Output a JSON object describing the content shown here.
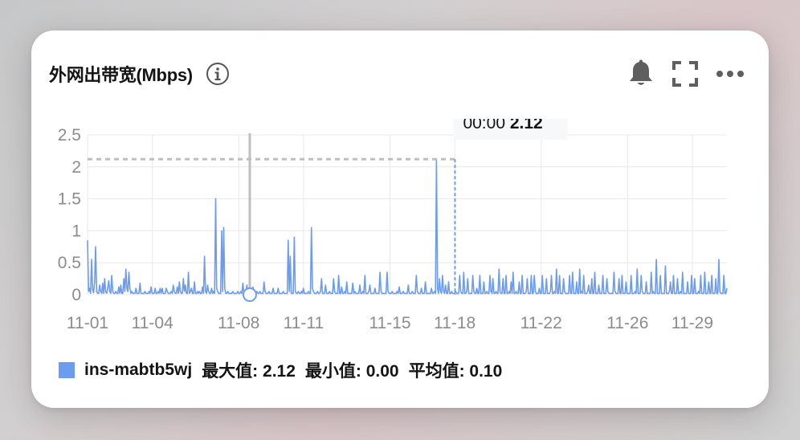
{
  "card": {
    "title": "外网出带宽(Mbps)",
    "icons": {
      "info": "info-circle-icon",
      "alert": "bell-icon",
      "fullscreen": "expand-icon",
      "more": "more-dots-icon"
    }
  },
  "legend": {
    "name": "ins-mabtb5wj",
    "max_label": "最大值: 2.12",
    "min_label": "最小值: 0.00",
    "avg_label": "平均值: 0.10"
  },
  "tooltip": {
    "time": "00:00",
    "value": "2.12"
  },
  "colors": {
    "series": "#6b9cf0",
    "grid": "#e8e8e8",
    "axis_text": "#8c8c8c",
    "crosshair": "#bfbfbf"
  },
  "chart_data": {
    "type": "line",
    "ylim": [
      0,
      2.5
    ],
    "yticks": [
      "0",
      "0.5",
      "1",
      "1.5",
      "2",
      "2.5"
    ],
    "ytick_values": [
      0,
      0.5,
      1,
      1.5,
      2,
      2.5
    ],
    "xticks": [
      "11-01",
      "11-04",
      "11-08",
      "11-11",
      "11-15",
      "11-18",
      "11-22",
      "11-26",
      "11-29"
    ],
    "xrange_days": [
      1,
      30.6
    ],
    "xtick_days": [
      1,
      4,
      8,
      11,
      15,
      18,
      22,
      26,
      29
    ],
    "grid": true,
    "legend_position": "bottom-left",
    "series": [
      {
        "name": "ins-mabtb5wj",
        "y": [
          0.85,
          0.05,
          0.1,
          0.02,
          0.55,
          0.08,
          0.03,
          0.2,
          0.75,
          0.05,
          0.02,
          0.02,
          0.15,
          0.05,
          0.02,
          0.18,
          0.02,
          0.25,
          0.04,
          0.02,
          0.1,
          0.22,
          0.05,
          0.02,
          0.3,
          0.05,
          0.02,
          0.02,
          0.05,
          0.02,
          0.02,
          0.12,
          0.02,
          0.15,
          0.02,
          0.02,
          0.25,
          0.05,
          0.4,
          0.1,
          0.05,
          0.35,
          0.1,
          0.02,
          0.05,
          0.02,
          0.02,
          0.02,
          0.1,
          0.02,
          0.02,
          0.02,
          0.18,
          0.02,
          0.02,
          0.02,
          0.02,
          0.05,
          0.02,
          0.02,
          0.02,
          0.05,
          0.02,
          0.12,
          0.02,
          0.02,
          0.02,
          0.1,
          0.02,
          0.02,
          0.05,
          0.02,
          0.1,
          0.02,
          0.1,
          0.02,
          0.02,
          0.02,
          0.1,
          0.05,
          0.02,
          0.02,
          0.02,
          0.05,
          0.02,
          0.15,
          0.05,
          0.02,
          0.02,
          0.12,
          0.02,
          0.2,
          0.05,
          0.02,
          0.02,
          0.25,
          0.05,
          0.15,
          0.02,
          0.02,
          0.35,
          0.02,
          0.05,
          0.1,
          0.02,
          0.02,
          0.2,
          0.02,
          0.02,
          0.05,
          0.02,
          0.05,
          0.02,
          0.02,
          0.12,
          0.02,
          0.6,
          0.05,
          0.02,
          0.15,
          0.05,
          0.02,
          0.02,
          0.1,
          0.02,
          0.05,
          0.02,
          1.5,
          0.1,
          0.05,
          0.02,
          0.02,
          0.02,
          1.0,
          0.05,
          1.05,
          0.1,
          0.02,
          0.02,
          0.05,
          0.02,
          0.02,
          0.02,
          0.02,
          0.05,
          0.02,
          0.02,
          0.02,
          0.02,
          0.05,
          0.02,
          0.02,
          0.05,
          0.02,
          0.18,
          0.02,
          0.02,
          0.02,
          0.15,
          0.02,
          0.02,
          0.05,
          0.02,
          0.02,
          0.12,
          0.02,
          0.02,
          0.02,
          0.05,
          0.02,
          0.02,
          0.05,
          0.02,
          0.02,
          0.02,
          0.2,
          0.05,
          0.02,
          0.02,
          0.02,
          0.05,
          0.02,
          0.02,
          0.02,
          0.1,
          0.02,
          0.02,
          0.02,
          0.02,
          0.1,
          0.02,
          0.02,
          0.02,
          0.02,
          0.05,
          0.02,
          0.02,
          0.02,
          0.02,
          0.85,
          0.05,
          0.6,
          0.02,
          0.02,
          0.02,
          0.9,
          0.05,
          0.02,
          0.02,
          0.05,
          0.02,
          0.02,
          0.05,
          0.02,
          0.1,
          0.02,
          0.02,
          0.02,
          0.02,
          0.05,
          0.02,
          0.02,
          1.05,
          0.1,
          0.05,
          0.02,
          0.02,
          0.02,
          0.05,
          0.02,
          0.02,
          0.05,
          0.25,
          0.02,
          0.02,
          0.02,
          0.15,
          0.02,
          0.02,
          0.02,
          0.05,
          0.02,
          0.02,
          0.02,
          0.25,
          0.05,
          0.02,
          0.02,
          0.02,
          0.3,
          0.02,
          0.02,
          0.12,
          0.02,
          0.02,
          0.05,
          0.02,
          0.2,
          0.02,
          0.02,
          0.02,
          0.02,
          0.02,
          0.18,
          0.02,
          0.05,
          0.02,
          0.02,
          0.02,
          0.02,
          0.15,
          0.02,
          0.02,
          0.05,
          0.02,
          0.3,
          0.02,
          0.02,
          0.02,
          0.05,
          0.15,
          0.02,
          0.02,
          0.02,
          0.02,
          0.1,
          0.02,
          0.02,
          0.02,
          0.02,
          0.35,
          0.05,
          0.02,
          0.02,
          0.02,
          0.02,
          0.02,
          0.35,
          0.05,
          0.02,
          0.02,
          0.02,
          0.05,
          0.02,
          0.02,
          0.02,
          0.02,
          0.05,
          0.02,
          0.12,
          0.02,
          0.02,
          0.02,
          0.05,
          0.02,
          0.02,
          0.02,
          0.02,
          0.15,
          0.02,
          0.02,
          0.02,
          0.05,
          0.02,
          0.02,
          0.02,
          0.3,
          0.05,
          0.02,
          0.02,
          0.02,
          0.1,
          0.02,
          0.02,
          0.02,
          0.2,
          0.02,
          0.02,
          0.02,
          0.02,
          0.02,
          0.1,
          0.02,
          0.02,
          0.05,
          0.02,
          2.12,
          0.1,
          0.02,
          0.25,
          0.05,
          0.02,
          0.3,
          0.05,
          0.02,
          0.15,
          0.02,
          0.02,
          0.2,
          0.02,
          0.02,
          0.05,
          0.02,
          0.02,
          0.02,
          0.05,
          0.02,
          0.02,
          0.02,
          0.3,
          0.05,
          0.02,
          0.02,
          0.35,
          0.02,
          0.02,
          0.05,
          0.25,
          0.02,
          0.02,
          0.02,
          0.02,
          0.3,
          0.05,
          0.02,
          0.02,
          0.1,
          0.02,
          0.02,
          0.3,
          0.02,
          0.02,
          0.02,
          0.2,
          0.02,
          0.02,
          0.05,
          0.02,
          0.02,
          0.3,
          0.05,
          0.02,
          0.25,
          0.02,
          0.02,
          0.05,
          0.02,
          0.02,
          0.4,
          0.05,
          0.02,
          0.02,
          0.25,
          0.02,
          0.02,
          0.3,
          0.02,
          0.02,
          0.05,
          0.02,
          0.2,
          0.02,
          0.35,
          0.02,
          0.02,
          0.05,
          0.02,
          0.02,
          0.2,
          0.02,
          0.02,
          0.3,
          0.02,
          0.02,
          0.02,
          0.05,
          0.25,
          0.02,
          0.02,
          0.02,
          0.3,
          0.02,
          0.02,
          0.3,
          0.05,
          0.02,
          0.02,
          0.02,
          0.1,
          0.02,
          0.02,
          0.3,
          0.02,
          0.02,
          0.02,
          0.25,
          0.02,
          0.02,
          0.02,
          0.05,
          0.3,
          0.02,
          0.02,
          0.05,
          0.02,
          0.4,
          0.02,
          0.02,
          0.3,
          0.02,
          0.02,
          0.02,
          0.25,
          0.05,
          0.02,
          0.02,
          0.02,
          0.02,
          0.3,
          0.02,
          0.02,
          0.35,
          0.02,
          0.02,
          0.02,
          0.2,
          0.02,
          0.02,
          0.4,
          0.02,
          0.05,
          0.02,
          0.3,
          0.02,
          0.02,
          0.02,
          0.05,
          0.15,
          0.02,
          0.02,
          0.25,
          0.02,
          0.02,
          0.35,
          0.02,
          0.02,
          0.02,
          0.15,
          0.02,
          0.02,
          0.02,
          0.3,
          0.02,
          0.02,
          0.02,
          0.25,
          0.05,
          0.02,
          0.02,
          0.02,
          0.02,
          0.02,
          0.35,
          0.05,
          0.02,
          0.02,
          0.02,
          0.25,
          0.02,
          0.02,
          0.3,
          0.02,
          0.02,
          0.02,
          0.2,
          0.02,
          0.02,
          0.02,
          0.02,
          0.3,
          0.02,
          0.02,
          0.02,
          0.05,
          0.02,
          0.4,
          0.02,
          0.02,
          0.02,
          0.3,
          0.05,
          0.02,
          0.02,
          0.02,
          0.2,
          0.02,
          0.02,
          0.02,
          0.02,
          0.35,
          0.02,
          0.05,
          0.02,
          0.02,
          0.55,
          0.02,
          0.02,
          0.02,
          0.3,
          0.02,
          0.02,
          0.02,
          0.02,
          0.45,
          0.02,
          0.02,
          0.02,
          0.05,
          0.2,
          0.02,
          0.02,
          0.3,
          0.02,
          0.02,
          0.02,
          0.25,
          0.02,
          0.02,
          0.05,
          0.02,
          0.35,
          0.02,
          0.02,
          0.02,
          0.02,
          0.2,
          0.02,
          0.02,
          0.02,
          0.3,
          0.02,
          0.02,
          0.25,
          0.02,
          0.02,
          0.02,
          0.05,
          0.02,
          0.3,
          0.02,
          0.02,
          0.02,
          0.35,
          0.02,
          0.02,
          0.02,
          0.2,
          0.02,
          0.02,
          0.3,
          0.02,
          0.02,
          0.02,
          0.25,
          0.02,
          0.02,
          0.55,
          0.05,
          0.02,
          0.02,
          0.02,
          0.3,
          0.02,
          0.02,
          0.1
        ]
      }
    ],
    "highlight": {
      "index_fraction": 0.5747,
      "value": 2.12,
      "time": "00:00"
    },
    "hover_marker_fraction": 0.2537
  }
}
